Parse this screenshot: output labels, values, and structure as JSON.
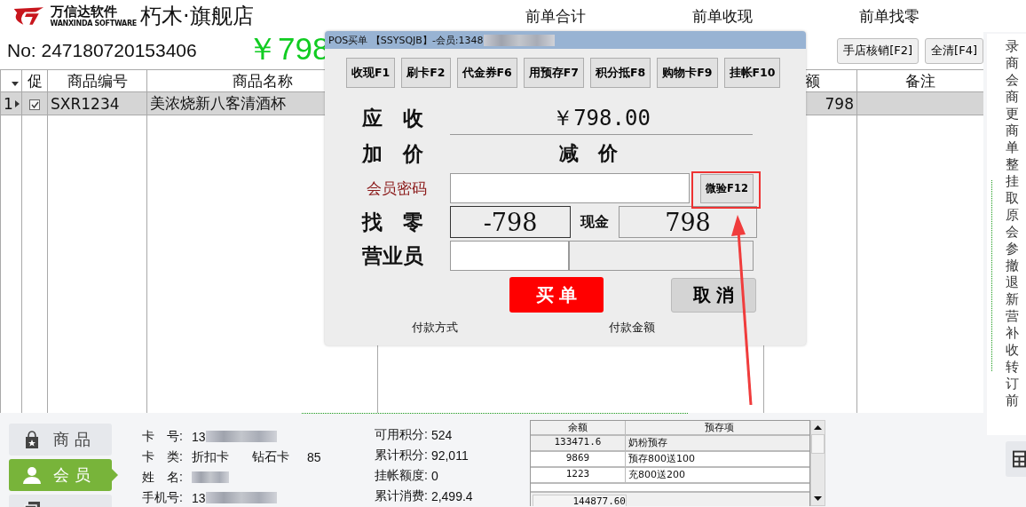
{
  "header": {
    "logo_title": "万信达软件",
    "logo_subtitle": "WANXINDA SOFTWARE",
    "store_name": "朽木·旗舰店",
    "summary_labels": [
      "前单合计",
      "前单收现",
      "前单找零"
    ]
  },
  "order": {
    "number": "No: 247180720153406",
    "total": "￥798"
  },
  "actions": [
    "手店核销[F2]",
    "全清[F4]"
  ],
  "grid": {
    "columns": [
      "促",
      "商品编号",
      "商品名称",
      "额",
      "备注"
    ],
    "rows": [
      {
        "index": "1",
        "selected": true,
        "promo_checked": true,
        "code": "SXR1234",
        "name": "美浓烧新八客清酒杯",
        "column_5": "798"
      }
    ]
  },
  "side_menu": [
    "录",
    "商",
    "会",
    "商",
    "更",
    "商",
    "单",
    "整",
    "挂",
    "取",
    "原",
    "会",
    "参",
    "撤",
    "退",
    "新",
    "营",
    "补",
    "收",
    "转",
    "订",
    "前"
  ],
  "bottom_tabs": [
    {
      "label": "商品",
      "selected": false
    },
    {
      "label": "会员",
      "selected": true
    },
    {
      "selected": false
    }
  ],
  "member": [
    {
      "label": "卡　号:",
      "value": "13",
      "redacted": true
    },
    {
      "label": "卡　类:",
      "value": "折扣卡",
      "level_name": "钻石卡",
      "discount": "85"
    },
    {
      "label": "姓　名:",
      "redacted": true
    },
    {
      "label": "手机号:",
      "value": "13",
      "redacted": true
    }
  ],
  "points": [
    {
      "label": "可用积分:",
      "value": "524"
    },
    {
      "label": "累计积分:",
      "value": "92,011"
    },
    {
      "label": "挂帐额度:",
      "value": "0"
    },
    {
      "label": "累计消费:",
      "value": "2,499.4"
    }
  ],
  "deposits": {
    "columns": [
      "余额",
      "预存项"
    ],
    "rows": [
      {
        "balance": "133471.6",
        "item": "奶粉预存",
        "selected": true
      },
      {
        "balance": "9869",
        "item": "预存800送100",
        "selected": false
      },
      {
        "balance": "1223",
        "item": "充800送200",
        "selected": false
      }
    ],
    "total": "144877.60"
  },
  "dialog": {
    "title": "POS买单 【SSYSQJB】-会员:1348",
    "title_redacted": true,
    "methods": [
      "收现F1",
      "刷卡F2",
      "代金券F6",
      "用预存F7",
      "积分抵F8",
      "购物卡F9",
      "挂帐F10"
    ],
    "due_label": "应　收",
    "due_value": "￥798.00",
    "markup_label": "加　价",
    "discount_label": "减　价",
    "password_label": "会员密码",
    "verify_button": "微验F12",
    "verify_highlighted": true,
    "change_label": "找　零",
    "change_value": "-798",
    "cash_label": "现金",
    "cash_value": "798",
    "clerk_label": "营业员",
    "pay_button": "买 单",
    "cancel_button": "取 消",
    "footer_labels": [
      "付款方式",
      "付款金额"
    ]
  }
}
